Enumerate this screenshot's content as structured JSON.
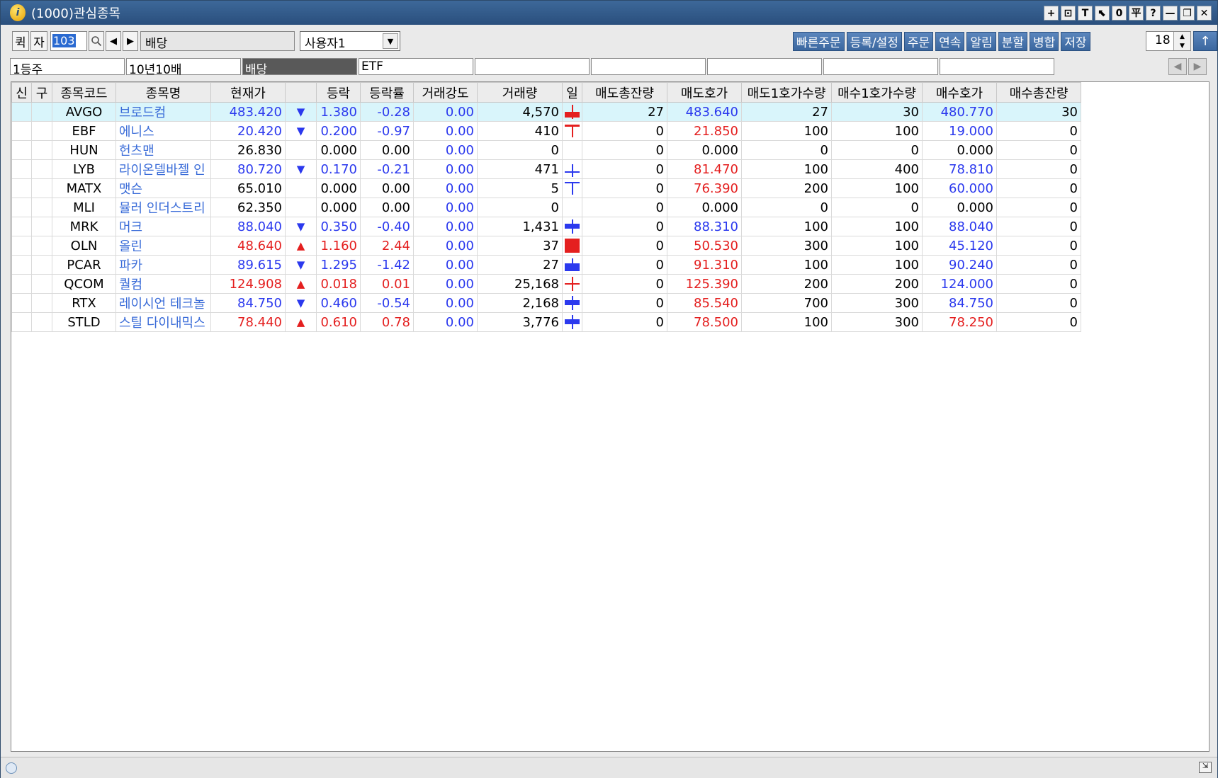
{
  "window": {
    "title": "(1000)관심종목"
  },
  "title_buttons": [
    "+",
    "⊡",
    "T",
    "⬉",
    "0",
    "平",
    "?",
    "—",
    "❐",
    "✕"
  ],
  "toolbar": {
    "quick_label": "퀵",
    "self_label": "자",
    "code_value": "103",
    "group_name": "배당",
    "user_select": "사용자1",
    "actions": [
      "빠른주문",
      "등록/설정",
      "주문",
      "연속",
      "알림",
      "분할",
      "병합",
      "저장"
    ],
    "count_value": "18",
    "up_label": "↑"
  },
  "tabs": [
    "1등주",
    "10년10배",
    "배당",
    "ETF",
    "",
    "",
    "",
    "",
    ""
  ],
  "active_tab": 2,
  "table": {
    "headers": [
      "신",
      "구",
      "종목코드",
      "종목명",
      "현재가",
      "",
      "등락",
      "등락률",
      "거래강도",
      "거래량",
      "일",
      "매도총잔량",
      "매도호가",
      "매도1호가수량",
      "매수1호가수량",
      "매수호가",
      "매수총잔량"
    ],
    "rows": [
      {
        "code": "AVGO",
        "name": "브로드컴",
        "price": "483.420",
        "dir": "down",
        "change": "1.380",
        "rate": "-0.28",
        "strength": "0.00",
        "volume": "4,570",
        "ask_total": "27",
        "ask": "483.640",
        "ask1_qty": "27",
        "bid1_qty": "30",
        "bid": "480.770",
        "bid_total": "30",
        "ask_color": "blue",
        "bid_color": "blue",
        "candle": "red-body-low"
      },
      {
        "code": "EBF",
        "name": "에니스",
        "price": "20.420",
        "dir": "down",
        "change": "0.200",
        "rate": "-0.97",
        "strength": "0.00",
        "volume": "410",
        "ask_total": "0",
        "ask": "21.850",
        "ask1_qty": "100",
        "bid1_qty": "100",
        "bid": "19.000",
        "bid_total": "0",
        "ask_color": "red",
        "bid_color": "blue",
        "candle": "red-t"
      },
      {
        "code": "HUN",
        "name": "헌츠맨",
        "price": "26.830",
        "dir": "none",
        "change": "0.000",
        "rate": "0.00",
        "strength": "0.00",
        "volume": "0",
        "ask_total": "0",
        "ask": "0.000",
        "ask1_qty": "0",
        "bid1_qty": "0",
        "bid": "0.000",
        "bid_total": "0",
        "ask_color": "black",
        "bid_color": "black",
        "candle": "none"
      },
      {
        "code": "LYB",
        "name": "라이온델바젤 인",
        "price": "80.720",
        "dir": "down",
        "change": "0.170",
        "rate": "-0.21",
        "strength": "0.00",
        "volume": "471",
        "ask_total": "0",
        "ask": "81.470",
        "ask1_qty": "100",
        "bid1_qty": "400",
        "bid": "78.810",
        "bid_total": "0",
        "ask_color": "red",
        "bid_color": "blue",
        "candle": "blue-cross-low"
      },
      {
        "code": "MATX",
        "name": "맷슨",
        "price": "65.010",
        "dir": "none",
        "change": "0.000",
        "rate": "0.00",
        "strength": "0.00",
        "volume": "5",
        "ask_total": "0",
        "ask": "76.390",
        "ask1_qty": "200",
        "bid1_qty": "100",
        "bid": "60.000",
        "bid_total": "0",
        "ask_color": "red",
        "bid_color": "blue",
        "candle": "blue-t"
      },
      {
        "code": "MLI",
        "name": "뮬러 인더스트리",
        "price": "62.350",
        "dir": "none",
        "change": "0.000",
        "rate": "0.00",
        "strength": "0.00",
        "volume": "0",
        "ask_total": "0",
        "ask": "0.000",
        "ask1_qty": "0",
        "bid1_qty": "0",
        "bid": "0.000",
        "bid_total": "0",
        "ask_color": "black",
        "bid_color": "black",
        "candle": "none"
      },
      {
        "code": "MRK",
        "name": "머크",
        "price": "88.040",
        "dir": "down",
        "change": "0.350",
        "rate": "-0.40",
        "strength": "0.00",
        "volume": "1,431",
        "ask_total": "0",
        "ask": "88.310",
        "ask1_qty": "100",
        "bid1_qty": "100",
        "bid": "88.040",
        "bid_total": "0",
        "ask_color": "blue",
        "bid_color": "blue",
        "candle": "blue-body-mid"
      },
      {
        "code": "OLN",
        "name": "올린",
        "price": "48.640",
        "dir": "up",
        "change": "1.160",
        "rate": "2.44",
        "strength": "0.00",
        "volume": "37",
        "ask_total": "0",
        "ask": "50.530",
        "ask1_qty": "300",
        "bid1_qty": "100",
        "bid": "45.120",
        "bid_total": "0",
        "ask_color": "red",
        "bid_color": "blue",
        "candle": "red-body-full"
      },
      {
        "code": "PCAR",
        "name": "파카",
        "price": "89.615",
        "dir": "down",
        "change": "1.295",
        "rate": "-1.42",
        "strength": "0.00",
        "volume": "27",
        "ask_total": "0",
        "ask": "91.310",
        "ask1_qty": "100",
        "bid1_qty": "100",
        "bid": "90.240",
        "bid_total": "0",
        "ask_color": "red",
        "bid_color": "blue",
        "candle": "blue-body-low"
      },
      {
        "code": "QCOM",
        "name": "퀄컴",
        "price": "124.908",
        "dir": "up",
        "change": "0.018",
        "rate": "0.01",
        "strength": "0.00",
        "volume": "25,168",
        "ask_total": "0",
        "ask": "125.390",
        "ask1_qty": "200",
        "bid1_qty": "200",
        "bid": "124.000",
        "bid_total": "0",
        "ask_color": "red",
        "bid_color": "blue",
        "candle": "red-cross"
      },
      {
        "code": "RTX",
        "name": "레이시언 테크놀",
        "price": "84.750",
        "dir": "down",
        "change": "0.460",
        "rate": "-0.54",
        "strength": "0.00",
        "volume": "2,168",
        "ask_total": "0",
        "ask": "85.540",
        "ask1_qty": "700",
        "bid1_qty": "300",
        "bid": "84.750",
        "bid_total": "0",
        "ask_color": "red",
        "bid_color": "blue",
        "candle": "blue-body-mid"
      },
      {
        "code": "STLD",
        "name": "스틸 다이내믹스",
        "price": "78.440",
        "dir": "up",
        "change": "0.610",
        "rate": "0.78",
        "strength": "0.00",
        "volume": "3,776",
        "ask_total": "0",
        "ask": "78.500",
        "ask1_qty": "100",
        "bid1_qty": "300",
        "bid": "78.250",
        "bid_total": "0",
        "ask_color": "red",
        "bid_color": "red",
        "candle": "blue-body-mid"
      }
    ]
  },
  "colors": {
    "up": "#e41f1f",
    "down": "#2b39ee",
    "name": "#3a6cd8",
    "selected_row": "#d9f5fb",
    "accent": "#3b679f"
  },
  "icons": {
    "app": "app-logo-icon",
    "search": "search-icon",
    "prev": "prev-arrow-icon",
    "next": "next-arrow-icon",
    "status": "globe-icon",
    "resize": "resize-grip-icon"
  }
}
